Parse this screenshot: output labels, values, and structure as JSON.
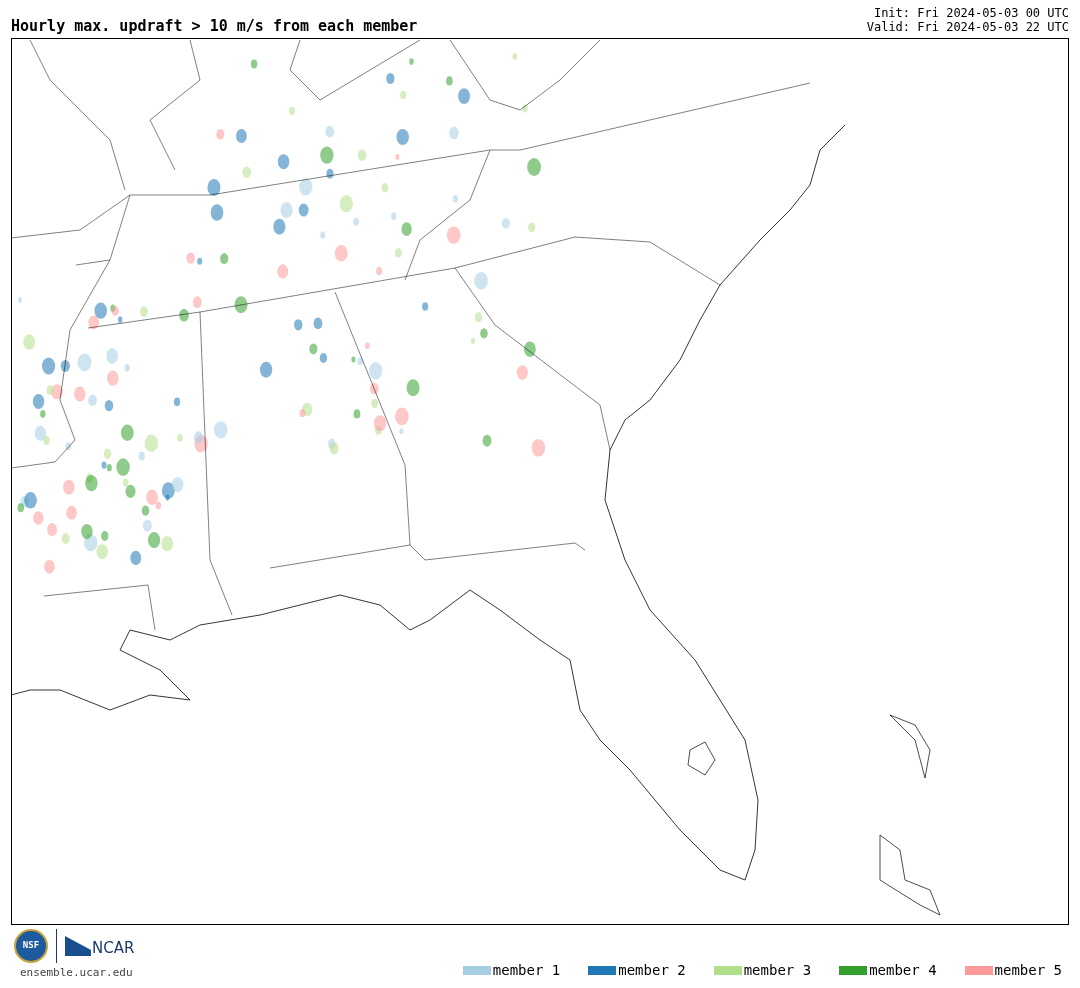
{
  "title": "Hourly max. updraft > 10 m/s from each member",
  "init": "Init: Fri 2024-05-03 00 UTC",
  "valid": "Valid: Fri 2024-05-03 22 UTC",
  "logo": {
    "nsf": "NSF",
    "ncar": "NCAR"
  },
  "site": "ensemble.ucar.edu",
  "legend": [
    {
      "label": "member 1",
      "color": "#a6cee3"
    },
    {
      "label": "member 2",
      "color": "#1f78b4"
    },
    {
      "label": "member 3",
      "color": "#b2df8a"
    },
    {
      "label": "member 4",
      "color": "#33a02c"
    },
    {
      "label": "member 5",
      "color": "#fb9a99"
    }
  ]
}
